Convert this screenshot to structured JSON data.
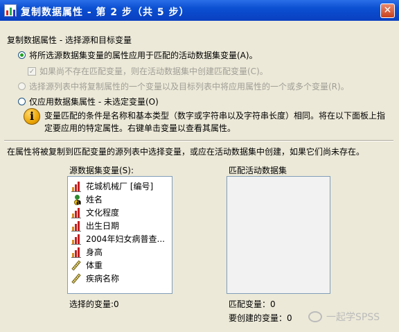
{
  "window": {
    "title": "复制数据属性 - 第 2 步（共 5 步）",
    "close_glyph": "✕"
  },
  "section_header": "复制数据属性 - 选择源和目标变量",
  "options": {
    "opt1_label": "将所选源数据集变量的属性应用于匹配的活动数据集变量(A)。",
    "opt1_sub_label": "如果尚不存在匹配变量，则在活动数据集中创建匹配变量(C)。",
    "opt2_label": "选择源列表中将复制属性的一个变量以及目标列表中将应用属性的一个或多个变量(R)。",
    "opt3_label": "仅应用数据集属性 - 未选定变量(O)"
  },
  "info": {
    "icon_glyph": "i",
    "text": "变量匹配的条件是名称和基本类型（数字或字符串以及字符串长度）相同。将在以下面板上指定要应用的特定属性。右键单击变量以查看其属性。"
  },
  "instruction": "在属性将被复制到匹配变量的源列表中选择变量，或应在活动数据集中创建，如果它们尚未存在。",
  "source": {
    "label": "源数据集变量(S):",
    "items": [
      {
        "icon": "ordinal-icon",
        "label": "花城机械厂 [编号]"
      },
      {
        "icon": "nominal-string-icon",
        "label": "姓名"
      },
      {
        "icon": "ordinal-icon",
        "label": "文化程度"
      },
      {
        "icon": "ordinal-icon",
        "label": "出生日期"
      },
      {
        "icon": "ordinal-icon",
        "label": "2004年妇女病普查..."
      },
      {
        "icon": "ordinal-icon",
        "label": "身高"
      },
      {
        "icon": "scale-icon",
        "label": "体重"
      },
      {
        "icon": "scale-icon",
        "label": "疾病名称"
      }
    ],
    "selected_label": "选择的变量:0"
  },
  "target": {
    "label": "匹配活动数据集",
    "matched_label": "匹配变量：0",
    "to_create_label": "要创建的变量：0"
  },
  "watermark": {
    "text": "一起学SPSS"
  }
}
